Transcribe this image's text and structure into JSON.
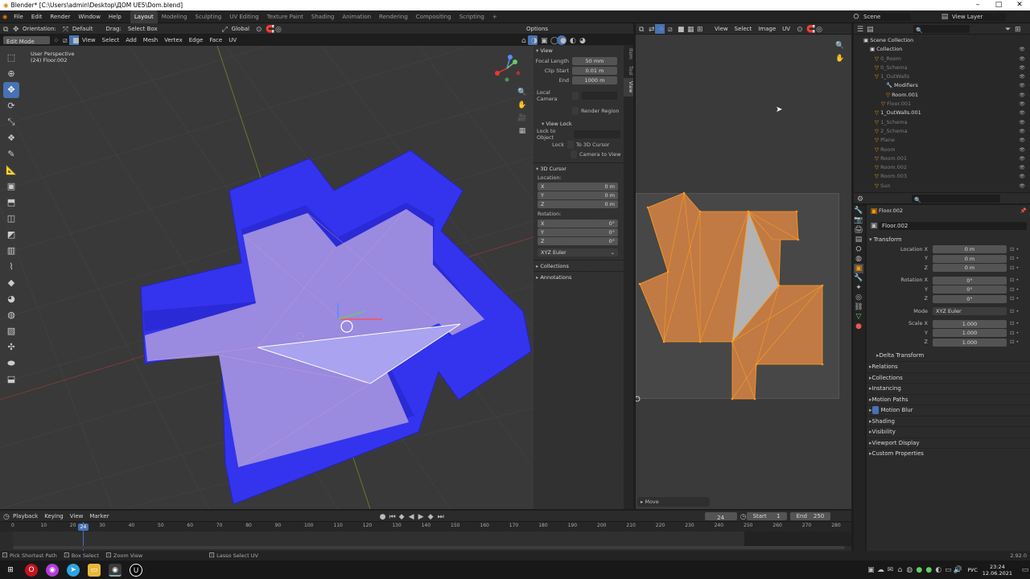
{
  "titlebar": {
    "title": "Blender* [C:\\Users\\admin\\Desktop\\ДОМ UE5\\Dom.blend]"
  },
  "menus": [
    "File",
    "Edit",
    "Render",
    "Window",
    "Help"
  ],
  "workspaces": [
    "Layout",
    "Modeling",
    "Sculpting",
    "UV Editing",
    "Texture Paint",
    "Shading",
    "Animation",
    "Rendering",
    "Compositing",
    "Scripting"
  ],
  "active_workspace": "Layout",
  "scene": {
    "label": "Scene",
    "view_layer": "View Layer"
  },
  "viewport_header": {
    "orientation_label": "Orientation:",
    "orientation": "Default",
    "drag_label": "Drag:",
    "drag": "Select Box",
    "transform": "Global",
    "options": "Options",
    "mode": "Edit Mode",
    "menus": [
      "View",
      "Select",
      "Add",
      "Mesh",
      "Vertex",
      "Edge",
      "Face",
      "UV"
    ]
  },
  "viewport": {
    "perspective": "User Perspective",
    "object": "(24) Floor.002"
  },
  "npanel": {
    "view_title": "View",
    "focal_label": "Focal Length",
    "focal": "50 mm",
    "clip_start_label": "Clip Start",
    "clip_start": "0.01 m",
    "end_label": "End",
    "end": "1000 m",
    "local_camera": "Local Camera",
    "render_region": "Render Region",
    "view_lock": "View Lock",
    "lock_object": "Lock to Object",
    "lock_label": "Lock",
    "to_cursor": "To 3D Cursor",
    "camera_to_view": "Camera to View",
    "cursor_title": "3D Cursor",
    "location_label": "Location:",
    "loc_x": "0 m",
    "loc_y": "0 m",
    "loc_z": "0 m",
    "rotation_label": "Rotation:",
    "rot_x": "0°",
    "rot_y": "0°",
    "rot_z": "0°",
    "rot_mode": "XYZ Euler",
    "collections": "Collections",
    "annotations": "Annotations",
    "tabs": [
      "Item",
      "Tool",
      "View"
    ]
  },
  "uv_header": {
    "menus": [
      "View",
      "Select",
      "Image",
      "UV"
    ]
  },
  "uv_editor": {
    "operator": "Move"
  },
  "outliner": {
    "root": "Scene Collection",
    "items": [
      {
        "name": "Collection",
        "dim": false
      },
      {
        "name": "0_Room",
        "dim": true
      },
      {
        "name": "0_Schema",
        "dim": true
      },
      {
        "name": "1_OutWalls",
        "dim": true
      },
      {
        "name": "Modifiers",
        "dim": false
      },
      {
        "name": "Room.001",
        "dim": false
      },
      {
        "name": "Floor.001",
        "dim": true
      },
      {
        "name": "1_OutWalls.001",
        "dim": false
      },
      {
        "name": "1_Schema",
        "dim": true
      },
      {
        "name": "2_Schema",
        "dim": true
      },
      {
        "name": "Plane",
        "dim": true
      },
      {
        "name": "Room",
        "dim": true
      },
      {
        "name": "Room.001",
        "dim": true
      },
      {
        "name": "Room.002",
        "dim": true
      },
      {
        "name": "Room.003",
        "dim": true
      },
      {
        "name": "Sun",
        "dim": true
      }
    ]
  },
  "properties": {
    "object": "Floor.002",
    "object_field": "Floor.002",
    "transform": "Transform",
    "loc_x_label": "Location X",
    "loc_y_label": "Y",
    "loc_z_label": "Z",
    "loc_x": "0 m",
    "loc_y": "0 m",
    "loc_z": "0 m",
    "rot_x_label": "Rotation X",
    "rot_y_label": "Y",
    "rot_z_label": "Z",
    "rot_x": "0°",
    "rot_y": "0°",
    "rot_z": "0°",
    "mode_label": "Mode",
    "mode": "XYZ Euler",
    "scale_x_label": "Scale X",
    "scale_y_label": "Y",
    "scale_z_label": "Z",
    "scale_x": "1.000",
    "scale_y": "1.000",
    "scale_z": "1.000",
    "sections": [
      "Delta Transform",
      "Relations",
      "Collections",
      "Instancing",
      "Motion Paths",
      "Motion Blur",
      "Shading",
      "Visibility",
      "Viewport Display",
      "Custom Properties"
    ]
  },
  "timeline": {
    "menus": [
      "Playback",
      "Keying",
      "View",
      "Marker"
    ],
    "current_frame": "24",
    "start_label": "Start",
    "start": "1",
    "end_label": "End",
    "end": "250",
    "ticks": [
      "0",
      "10",
      "20",
      "30",
      "40",
      "50",
      "60",
      "70",
      "80",
      "90",
      "100",
      "110",
      "120",
      "130",
      "140",
      "150",
      "160",
      "170",
      "180",
      "190",
      "200",
      "210",
      "220",
      "230",
      "240",
      "250",
      "260",
      "270",
      "280"
    ]
  },
  "statusbar": {
    "items": [
      "Pick Shortest Path",
      "Box Select",
      "Zoom View",
      "Lasso Select UV"
    ],
    "version": "2.92.0"
  },
  "taskbar": {
    "lang": "РУС",
    "time": "23:24",
    "date": "12.06.2021"
  },
  "colors": {
    "accent": "#4772b3",
    "walls": "#3434ee",
    "floor": "#9a8ae0",
    "uv_face": "#c17a44",
    "uv_edge": "#ff9c20"
  }
}
